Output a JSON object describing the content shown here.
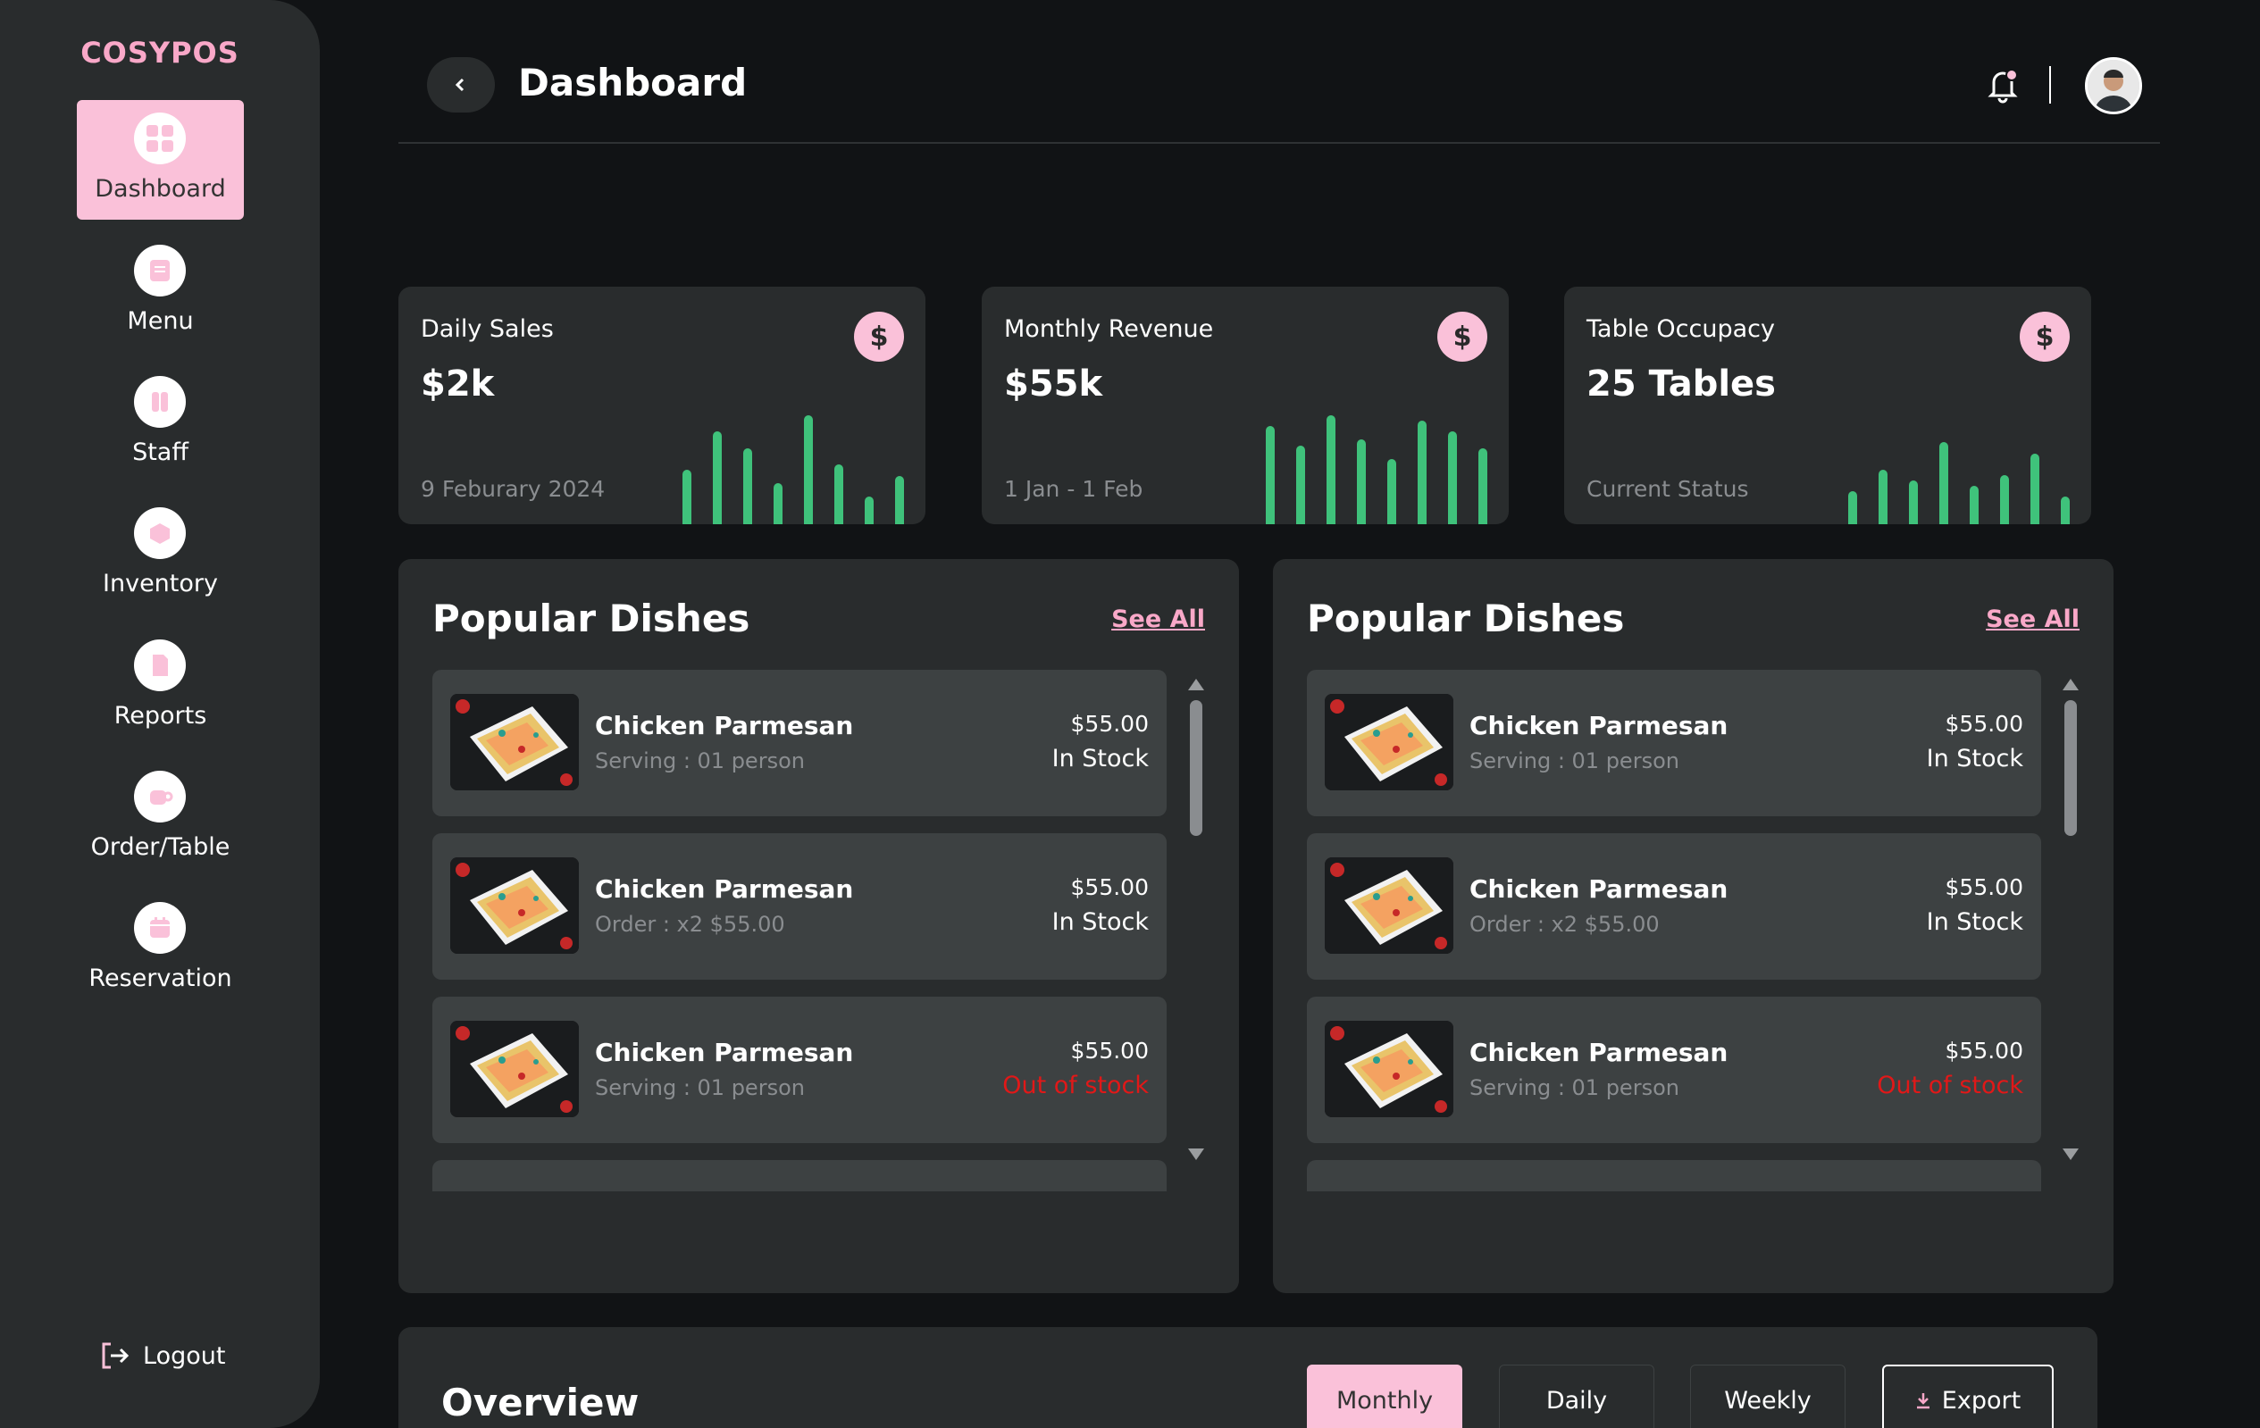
{
  "sidebar": {
    "brand": "COSYPOS",
    "items": [
      {
        "label": "Dashboard",
        "icon": "grid-icon"
      },
      {
        "label": "Menu",
        "icon": "menu-icon"
      },
      {
        "label": "Staff",
        "icon": "staff-icon"
      },
      {
        "label": "Inventory",
        "icon": "inventory-icon"
      },
      {
        "label": "Reports",
        "icon": "reports-icon"
      },
      {
        "label": "Order/Table",
        "icon": "order-table-icon"
      },
      {
        "label": "Reservation",
        "icon": "reservation-icon"
      }
    ],
    "logout_label": "Logout"
  },
  "header": {
    "title": "Dashboard"
  },
  "stats": [
    {
      "title": "Daily Sales",
      "value": "$2k",
      "sub": "9 Feburary 2024",
      "bars": [
        0.5,
        0.85,
        0.7,
        0.38,
        1.0,
        0.55,
        0.25,
        0.44
      ]
    },
    {
      "title": "Monthly Revenue",
      "value": "$55k",
      "sub": "1 Jan - 1 Feb",
      "bars": [
        0.9,
        0.72,
        1.0,
        0.78,
        0.6,
        0.95,
        0.85,
        0.7
      ]
    },
    {
      "title": "Table Occupacy",
      "value": "25 Tables",
      "sub": "Current Status",
      "bars": [
        0.3,
        0.5,
        0.4,
        0.75,
        0.35,
        0.45,
        0.65,
        0.25
      ]
    }
  ],
  "panels": [
    {
      "title": "Popular Dishes",
      "see_all": "See All",
      "dishes": [
        {
          "name": "Chicken Parmesan",
          "sub": "Serving : 01 person",
          "price": "$55.00",
          "stock": "In Stock",
          "out": false
        },
        {
          "name": "Chicken Parmesan",
          "sub": "Order : x2 $55.00",
          "price": "$55.00",
          "stock": "In Stock",
          "out": false
        },
        {
          "name": "Chicken Parmesan",
          "sub": "Serving : 01 person",
          "price": "$55.00",
          "stock": "Out of stock",
          "out": true
        }
      ]
    },
    {
      "title": "Popular Dishes",
      "see_all": "See All",
      "dishes": [
        {
          "name": "Chicken Parmesan",
          "sub": "Serving : 01 person",
          "price": "$55.00",
          "stock": "In Stock",
          "out": false
        },
        {
          "name": "Chicken Parmesan",
          "sub": "Order : x2 $55.00",
          "price": "$55.00",
          "stock": "In Stock",
          "out": false
        },
        {
          "name": "Chicken Parmesan",
          "sub": "Serving : 01 person",
          "price": "$55.00",
          "stock": "Out of stock",
          "out": true
        }
      ]
    }
  ],
  "overview": {
    "title": "Overview",
    "buttons": [
      "Monthly",
      "Daily",
      "Weekly"
    ],
    "export_label": "Export"
  },
  "colors": {
    "accent": "#FAC1D9",
    "bar": "#3FC27B",
    "out_of_stock": "#E11818"
  }
}
